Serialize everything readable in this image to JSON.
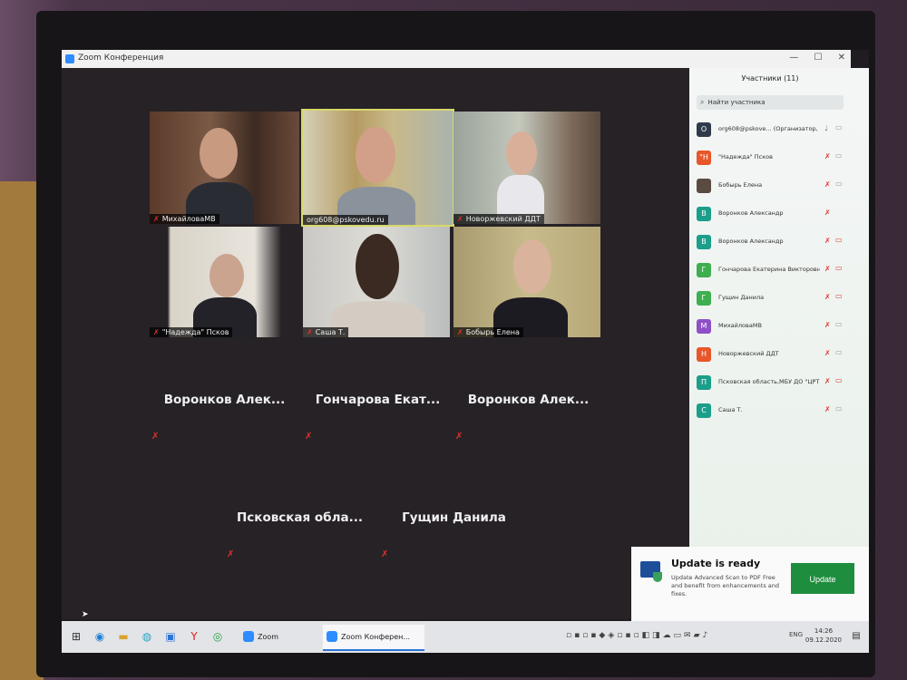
{
  "window": {
    "title": "Zoom Конференция"
  },
  "tiles": [
    {
      "name": "МихайловаМВ",
      "muted": true
    },
    {
      "name": "org608@pskovedu.ru",
      "muted": false
    },
    {
      "name": "Новоржевский ДДТ",
      "muted": true
    },
    {
      "name": "\"Надежда\" Псков",
      "muted": true
    },
    {
      "name": "Саша Т.",
      "muted": true
    },
    {
      "name": "Бобырь Елена",
      "muted": true
    }
  ],
  "text_tiles": [
    {
      "name": "Воронков Алек..."
    },
    {
      "name": "Гончарова Екат..."
    },
    {
      "name": "Воронков Алек..."
    },
    {
      "name": "Псковская обла..."
    },
    {
      "name": "Гущин Данила"
    }
  ],
  "participants_panel": {
    "title": "Участники (11)",
    "search_placeholder": "Найти участника",
    "items": [
      {
        "initial": "O",
        "color": "#2f3a4a",
        "name": "org608@pskove...   (Организатор, я)",
        "mic": "on",
        "cam": "on"
      },
      {
        "initial": "\"Н",
        "color": "#e8562a",
        "name": "\"Надежда\" Псков",
        "mic": "muted",
        "cam": "on"
      },
      {
        "initial": "",
        "color": "#5a4a40",
        "name": "Бобырь Елена",
        "mic": "muted",
        "cam": "on"
      },
      {
        "initial": "В",
        "color": "#1b9e8a",
        "name": "Воронков Александр",
        "mic": "muted",
        "cam": "none"
      },
      {
        "initial": "В",
        "color": "#1b9e8a",
        "name": "Воронков Александр",
        "mic": "muted",
        "cam": "off"
      },
      {
        "initial": "Г",
        "color": "#3fae4f",
        "name": "Гончарова Екатерина Викторовн...",
        "mic": "muted",
        "cam": "off"
      },
      {
        "initial": "Г",
        "color": "#3fae4f",
        "name": "Гущин Данила",
        "mic": "muted",
        "cam": "off"
      },
      {
        "initial": "М",
        "color": "#8e4fc7",
        "name": "МихайловаМВ",
        "mic": "muted",
        "cam": "on"
      },
      {
        "initial": "Н",
        "color": "#e8562a",
        "name": "Новоржевский ДДТ",
        "mic": "muted",
        "cam": "on"
      },
      {
        "initial": "П",
        "color": "#1b9e8a",
        "name": "Псковская область,МБУ ДО \"ЦРТ...",
        "mic": "muted",
        "cam": "off"
      },
      {
        "initial": "С",
        "color": "#1b9e8a",
        "name": "Саша Т.",
        "mic": "muted",
        "cam": "on"
      }
    ]
  },
  "toast": {
    "title": "Update is ready",
    "body": "Update Advanced Scan to PDF Free and benefit from enhancements and fixes.",
    "button": "Update"
  },
  "taskbar": {
    "apps": [
      {
        "label": "Zoom",
        "active": false
      },
      {
        "label": "Zoom Конферен...",
        "active": true
      }
    ],
    "lang": "ENG",
    "time": "14:26",
    "date": "09.12.2020"
  }
}
